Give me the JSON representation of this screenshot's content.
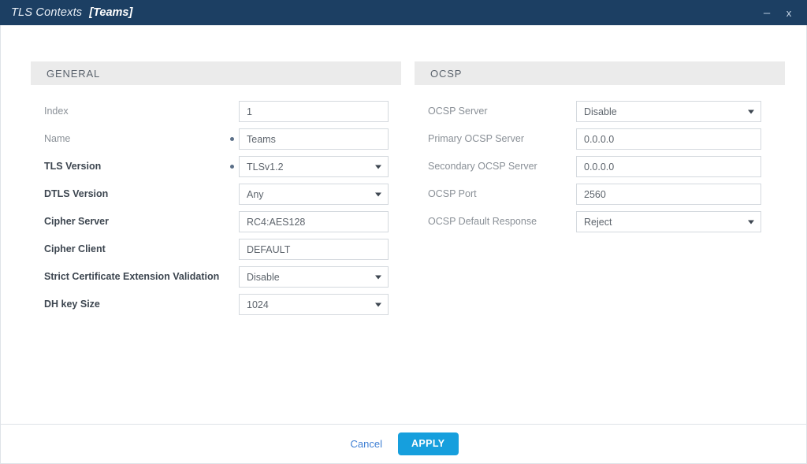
{
  "window": {
    "title": "TLS Contexts",
    "subtitle": "[Teams]",
    "minimize_icon": "–",
    "close_icon": "x"
  },
  "sections": {
    "general": {
      "header": "GENERAL",
      "rows": [
        {
          "label": "Index",
          "value": "1",
          "type": "text",
          "required": false,
          "enabled": false
        },
        {
          "label": "Name",
          "value": "Teams",
          "type": "text",
          "required": true,
          "enabled": false
        },
        {
          "label": "TLS Version",
          "value": "TLSv1.2",
          "type": "select",
          "required": true,
          "enabled": true
        },
        {
          "label": "DTLS Version",
          "value": "Any",
          "type": "select",
          "required": false,
          "enabled": true
        },
        {
          "label": "Cipher Server",
          "value": "RC4:AES128",
          "type": "text",
          "required": false,
          "enabled": true
        },
        {
          "label": "Cipher Client",
          "value": "DEFAULT",
          "type": "text",
          "required": false,
          "enabled": true
        },
        {
          "label": "Strict Certificate Extension Validation",
          "value": "Disable",
          "type": "select",
          "required": false,
          "enabled": true
        },
        {
          "label": "DH key Size",
          "value": "1024",
          "type": "select",
          "required": false,
          "enabled": true
        }
      ]
    },
    "ocsp": {
      "header": "OCSP",
      "rows": [
        {
          "label": "OCSP Server",
          "value": "Disable",
          "type": "select",
          "required": false,
          "enabled": false
        },
        {
          "label": "Primary OCSP Server",
          "value": "0.0.0.0",
          "type": "text",
          "required": false,
          "enabled": false
        },
        {
          "label": "Secondary OCSP Server",
          "value": "0.0.0.0",
          "type": "text",
          "required": false,
          "enabled": false
        },
        {
          "label": "OCSP Port",
          "value": "2560",
          "type": "text",
          "required": false,
          "enabled": false
        },
        {
          "label": "OCSP Default Response",
          "value": "Reject",
          "type": "select",
          "required": false,
          "enabled": false
        }
      ]
    }
  },
  "footer": {
    "cancel_label": "Cancel",
    "apply_label": "APPLY"
  },
  "colors": {
    "titlebar": "#1c3f63",
    "section_header": "#ebebeb",
    "apply_button": "#169fdd",
    "cancel_link": "#3f7fd4",
    "label_enabled": "#3d4650",
    "label_disabled": "#8a9097",
    "field_border": "#d4d9de",
    "required_dot": "#5b6f88"
  }
}
